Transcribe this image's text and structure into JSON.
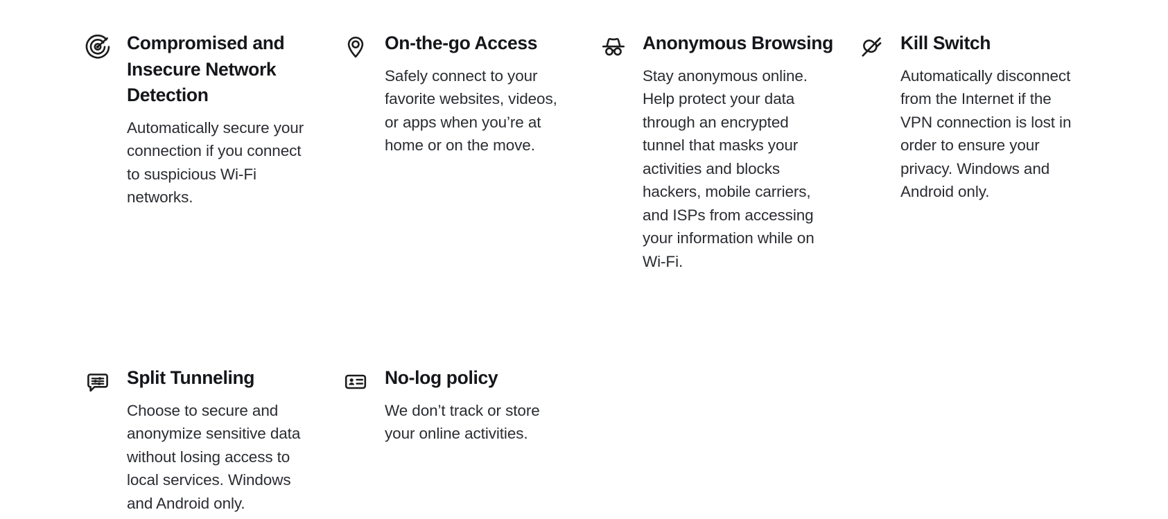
{
  "page": {
    "background_color": "#ffffff",
    "title_color": "#15161a",
    "body_color": "#2a2c31",
    "icon_color": "#1c1c1e"
  },
  "features": [
    {
      "icon": "target-arrow-icon",
      "title": "Compromised and Insecure Network Detection",
      "description": "Automatically secure your connection if you connect to suspicious Wi-Fi networks."
    },
    {
      "icon": "location-pin-icon",
      "title": "On-the-go Access",
      "description": "Safely connect to your favorite websites, videos, or apps when you’re at home or on the move."
    },
    {
      "icon": "incognito-hat-glasses-icon",
      "title": "Anonymous Browsing",
      "description": "Stay anonymous online. Help protect your data through an encrypted tunnel that masks your activities and blocks hackers, mobile carriers, and ISPs from accessing your information while on Wi-Fi."
    },
    {
      "icon": "unplugged-power-plug-icon",
      "title": "Kill Switch",
      "description": "Automatically disconnect from the Internet if the VPN connection is lost in order to ensure your privacy. Windows and Android only."
    },
    {
      "icon": "speech-bubble-sliders-icon",
      "title": "Split Tunneling",
      "description": "Choose to secure and anonymize sensitive data without losing access to local services. Windows and Android only."
    },
    {
      "icon": "id-card-icon",
      "title": "No-log policy",
      "description": "We don’t track or store your online activities."
    }
  ]
}
